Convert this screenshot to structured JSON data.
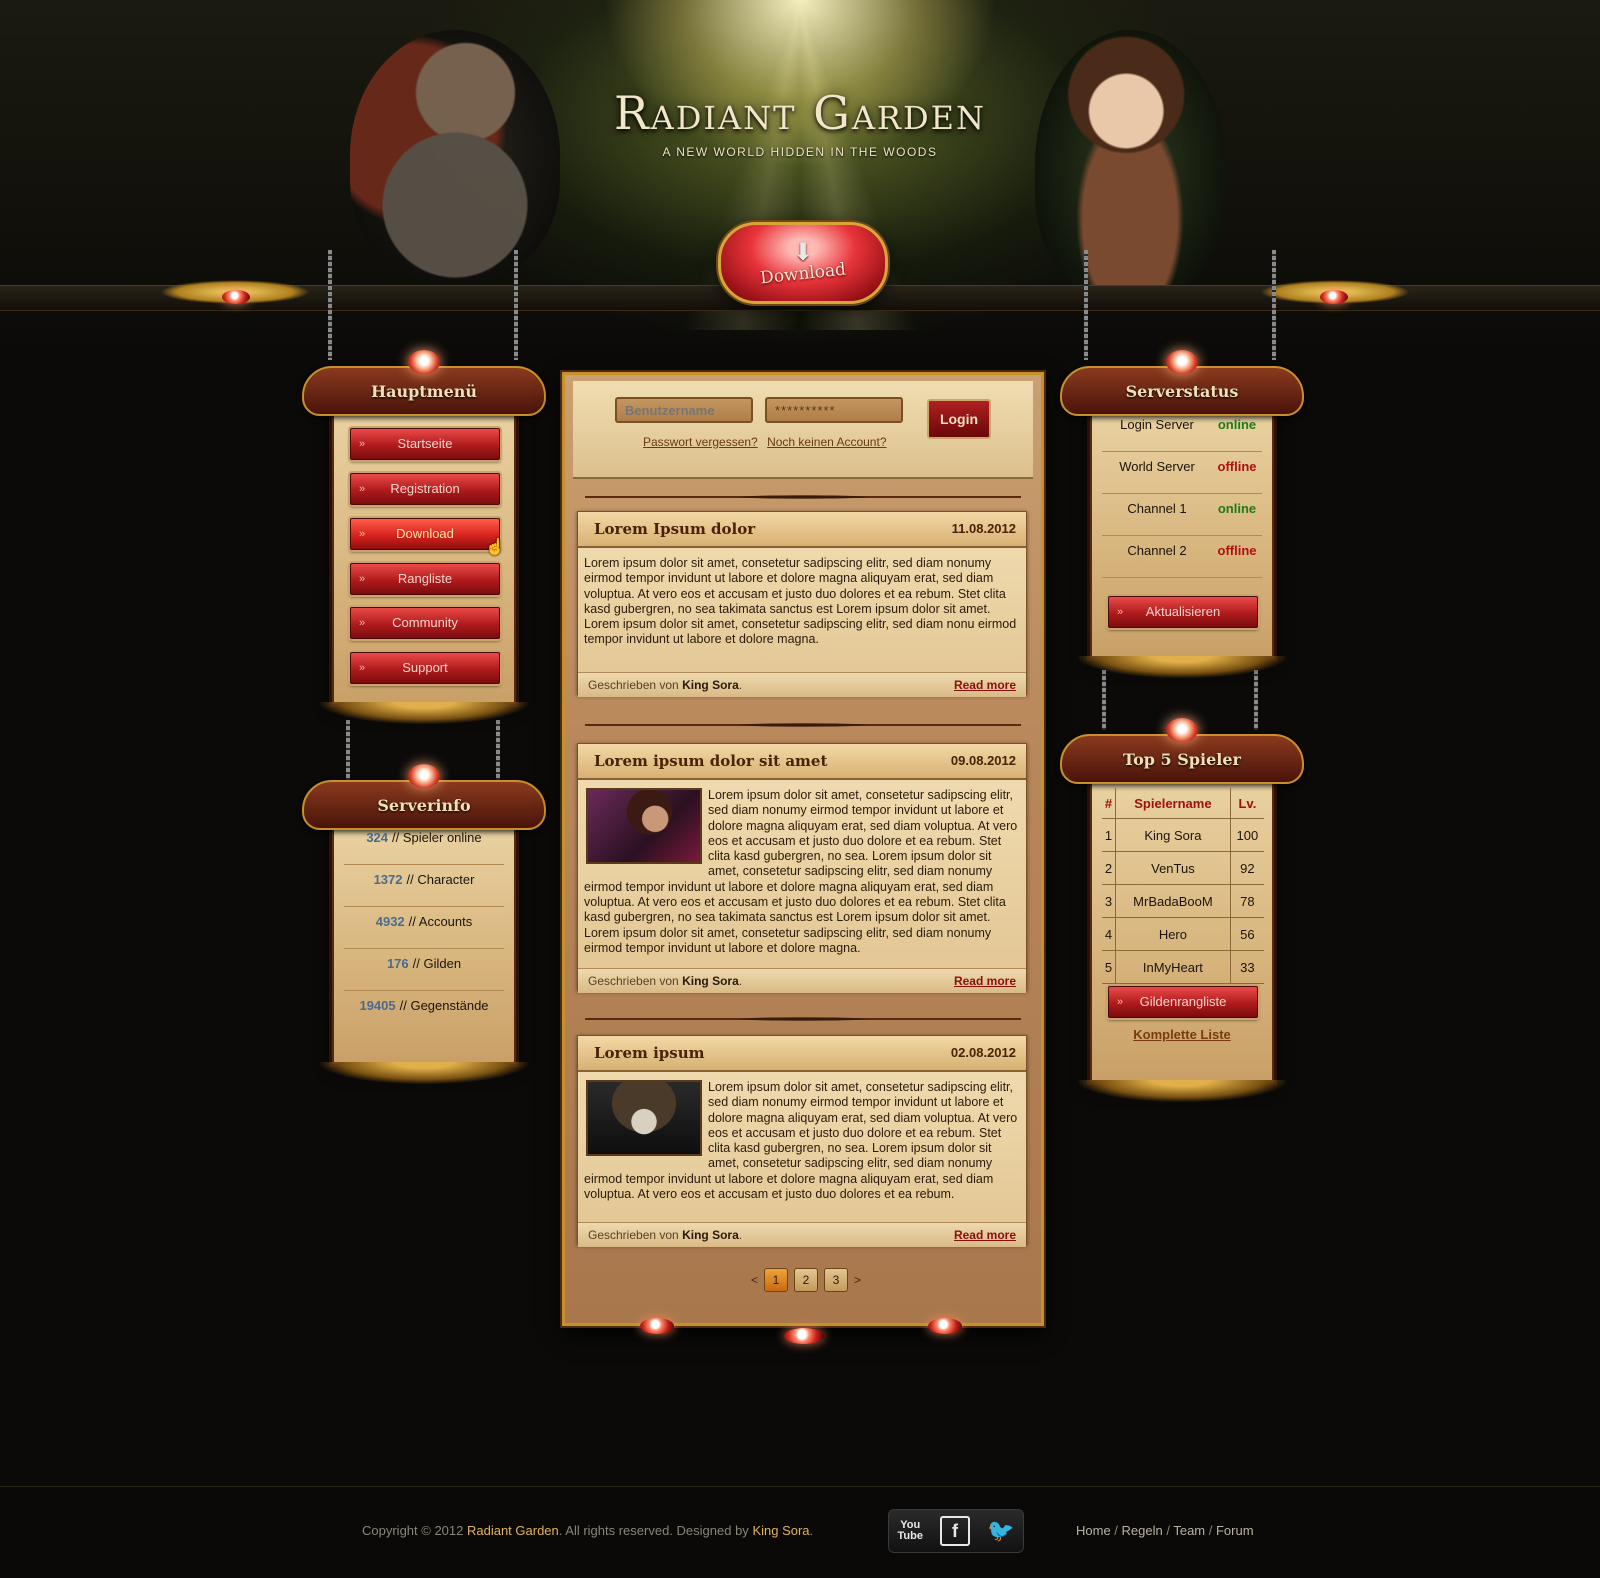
{
  "header": {
    "title": "Radiant Garden",
    "tagline": "A NEW WORLD HIDDEN IN THE WOODS",
    "download_label": "Download"
  },
  "main_menu": {
    "title": "Hauptmenü",
    "items": [
      {
        "label": "Startseite"
      },
      {
        "label": "Registration"
      },
      {
        "label": "Download"
      },
      {
        "label": "Rangliste"
      },
      {
        "label": "Community"
      },
      {
        "label": "Support"
      }
    ]
  },
  "server_info": {
    "title": "Serverinfo",
    "rows": [
      {
        "value": "324",
        "label": "// Spieler online"
      },
      {
        "value": "1372",
        "label": "// Character"
      },
      {
        "value": "4932",
        "label": "// Accounts"
      },
      {
        "value": "176",
        "label": "// Gilden"
      },
      {
        "value": "19405",
        "label": "// Gegenstände"
      }
    ]
  },
  "login": {
    "username_placeholder": "Benutzername",
    "password_value": "**********",
    "login_label": "Login",
    "forgot_label": "Passwort vergessen?",
    "no_account_label": "Noch keinen Account?"
  },
  "news": [
    {
      "title": "Lorem Ipsum dolor",
      "date": "11.08.2012",
      "body": "Lorem ipsum dolor sit amet, consetetur sadipscing elitr, sed diam nonumy eirmod tempor invidunt ut labore et dolore magna aliquyam erat, sed diam voluptua. At vero eos et accusam et justo duo dolores et ea rebum. Stet clita kasd gubergren, no sea takimata sanctus est Lorem ipsum dolor sit amet.",
      "body2": "Lorem ipsum dolor sit amet, consetetur sadipscing elitr, sed diam nonu eirmod tempor invidunt ut labore et dolore magna.",
      "written_by": "Geschrieben von",
      "author": "King Sora",
      "read_more": "Read more"
    },
    {
      "title": "Lorem ipsum dolor sit amet",
      "date": "09.08.2012",
      "body": "Lorem ipsum dolor sit amet, consetetur sadipscing elitr, sed diam nonumy eirmod tempor invidunt ut labore et dolore magna aliquyam erat, sed diam voluptua. At vero eos et accusam et justo duo dolore et ea rebum. Stet clita kasd gubergren, no sea. Lorem ipsum dolor sit amet, consetetur sadipscing elitr, sed diam nonumy eirmod tempor invidunt ut labore et dolore magna aliquyam erat, sed diam voluptua. At vero eos et accusam et justo duo dolores et ea rebum. Stet clita kasd gubergren, no sea takimata sanctus est Lorem ipsum dolor sit amet. Lorem ipsum dolor sit amet, consetetur sadipscing elitr, sed diam nonumy eirmod tempor invidunt ut labore et dolore magna.",
      "written_by": "Geschrieben von",
      "author": "King Sora",
      "read_more": "Read more"
    },
    {
      "title": "Lorem ipsum",
      "date": "02.08.2012",
      "body": "Lorem ipsum dolor sit amet, consetetur sadipscing elitr, sed diam nonumy eirmod tempor invidunt ut labore et dolore magna aliquyam erat, sed diam voluptua. At vero eos et accusam et justo duo dolore et ea rebum. Stet clita kasd gubergren, no sea. Lorem ipsum dolor sit amet, consetetur sadipscing elitr, sed diam nonumy eirmod tempor invidunt ut labore et dolore magna aliquyam erat, sed diam voluptua. At vero eos et accusam et justo duo dolores et ea rebum.",
      "written_by": "Geschrieben von",
      "author": "King Sora",
      "read_more": "Read more"
    }
  ],
  "pagination": {
    "prev": "<",
    "pages": [
      "1",
      "2",
      "3"
    ],
    "next": ">",
    "current": "1"
  },
  "server_status": {
    "title": "Serverstatus",
    "rows": [
      {
        "label": "Login Server",
        "status": "online"
      },
      {
        "label": "World Server",
        "status": "offline"
      },
      {
        "label": "Channel 1",
        "status": "online"
      },
      {
        "label": "Channel 2",
        "status": "offline"
      }
    ],
    "refresh_label": "Aktualisieren"
  },
  "top5": {
    "title": "Top 5 Spieler",
    "columns": [
      "#",
      "Spielername",
      "Lv."
    ],
    "rows": [
      [
        "1",
        "King Sora",
        "100"
      ],
      [
        "2",
        "VenTus",
        "92"
      ],
      [
        "3",
        "MrBadaBooM",
        "78"
      ],
      [
        "4",
        "Hero",
        "56"
      ],
      [
        "5",
        "InMyHeart",
        "33"
      ]
    ],
    "guild_button": "Gildenrangliste",
    "full_list_link": "Komplette Liste"
  },
  "footer": {
    "copyright_prefix": "Copyright © 2012",
    "site_name": "Radiant Garden",
    "copyright_mid": ". All rights reserved. Designed by",
    "designer": "King Sora",
    "copyright_end": ".",
    "social": {
      "youtube_top": "You",
      "youtube_bottom": "Tube",
      "facebook": "f",
      "twitter": "🐦"
    },
    "nav": [
      "Home",
      "Regeln",
      "Team",
      "Forum"
    ]
  },
  "colors": {
    "online": "#1f7a18",
    "offline": "#b01010",
    "accent_gold": "#c8902a",
    "button_red": "#b01a1c"
  }
}
